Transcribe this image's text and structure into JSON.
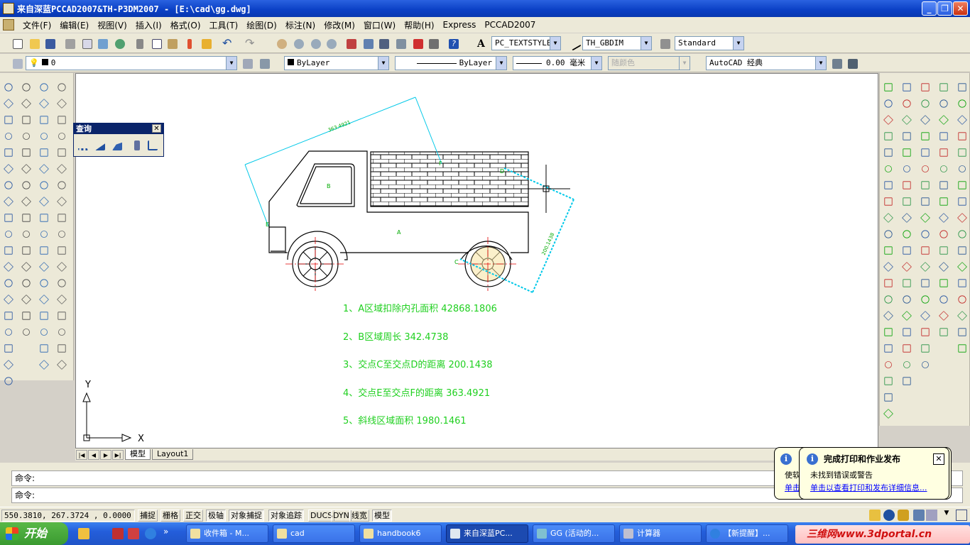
{
  "window": {
    "title": "来自深蓝PCCAD2007&TH-P3DM2007 - [E:\\cad\\gg.dwg]"
  },
  "menu": [
    "文件(F)",
    "编辑(E)",
    "视图(V)",
    "插入(I)",
    "格式(O)",
    "工具(T)",
    "绘图(D)",
    "标注(N)",
    "修改(M)",
    "窗口(W)",
    "帮助(H)",
    "Express",
    "PCCAD2007"
  ],
  "styles": {
    "text_style": "PC_TEXTSTYLE",
    "dim_style": "TH_GBDIM",
    "table_style": "Standard"
  },
  "layers": {
    "current": "0",
    "color": "ByLayer",
    "linetype": "ByLayer",
    "lineweight": "0.00 毫米",
    "plot_style": "随颜色",
    "workspace": "AutoCAD 经典"
  },
  "query_toolbar": {
    "title": "查询"
  },
  "drawing": {
    "dim_ef": "363.4921",
    "dim_cd": "200.1438",
    "labels": [
      "A",
      "B",
      "C",
      "D",
      "E",
      "F"
    ],
    "notes": [
      "1、A区域扣除内孔面积 42868.1806",
      "2、B区域周长 342.4738",
      "3、交点C至交点D的距离 200.1438",
      "4、交点E至交点F的距离 363.4921",
      "5、斜线区域面积 1980.1461"
    ],
    "ucs_x": "X",
    "ucs_y": "Y"
  },
  "tabs": [
    "模型",
    "Layout1"
  ],
  "command": {
    "prompt1": "命令:",
    "prompt2": "命令:"
  },
  "status": {
    "coords": "550.3810, 267.3724 , 0.0000",
    "buttons": [
      "捕捉",
      "栅格",
      "正交",
      "极轴",
      "对象捕捉",
      "对象追踪",
      "DUCS",
      "DYN",
      "线宽",
      "模型"
    ]
  },
  "balloon_back": {
    "line1": "使软",
    "line2": "单击"
  },
  "balloon": {
    "title": "完成打印和作业发布",
    "message": "未找到错误或警告",
    "link": "单击以查看打印和发布详细信息..."
  },
  "taskbar": {
    "start": "开始",
    "tasks": [
      "收件箱 - M...",
      "cad",
      "handbook6",
      "来自深蓝PC...",
      "GG (活动的...",
      "计算器",
      "【新提醒】..."
    ],
    "watermark": "三维网www.3dportal.cn"
  },
  "colors": {
    "drawing": "#00aa00",
    "dim": "#00c8e8",
    "text": "#20d020",
    "center": "#e00000"
  }
}
